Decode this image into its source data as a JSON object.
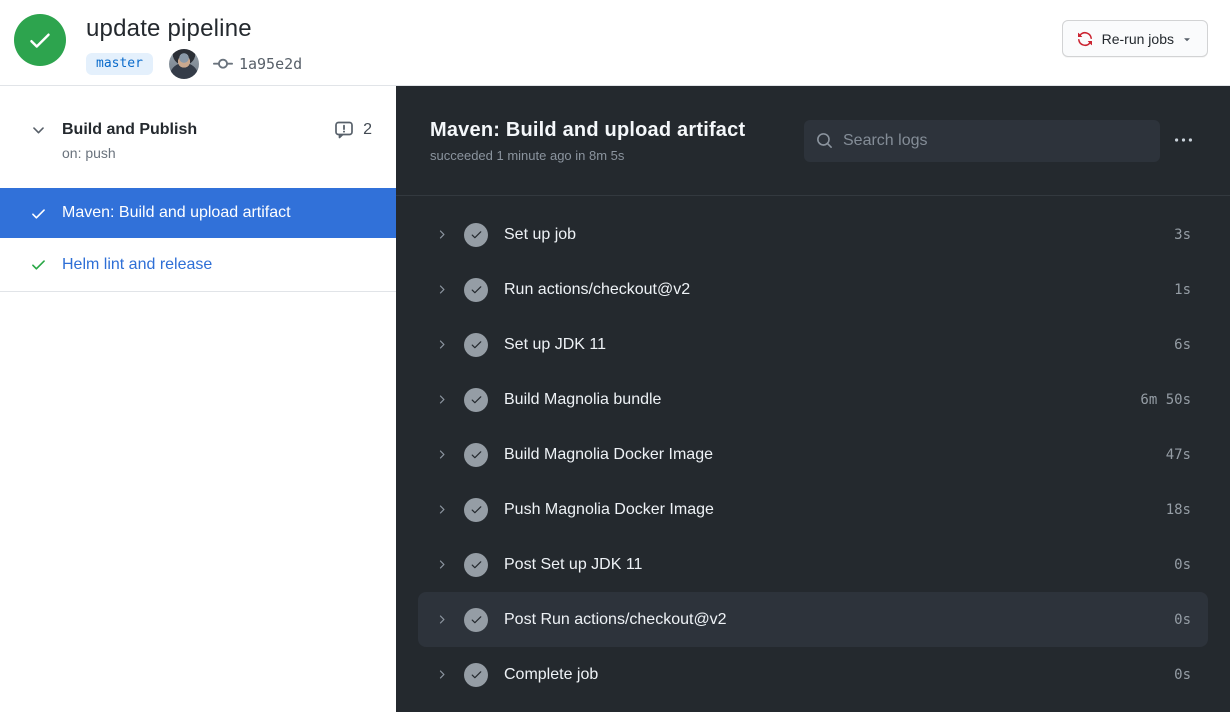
{
  "header": {
    "status": "success",
    "title": "update pipeline",
    "branch": "master",
    "commit_sha": "1a95e2d",
    "rerun_label": "Re-run jobs"
  },
  "sidebar": {
    "workflow_name": "Build and Publish",
    "trigger": "on: push",
    "annotations_count": "2",
    "jobs": [
      {
        "name": "Maven: Build and upload artifact",
        "status": "success",
        "selected": true
      },
      {
        "name": "Helm lint and release",
        "status": "success",
        "selected": false
      }
    ]
  },
  "main": {
    "job_title": "Maven: Build and upload artifact",
    "job_subtitle": "succeeded 1 minute ago in 8m 5s",
    "search": {
      "placeholder": "Search logs",
      "value": ""
    },
    "steps": [
      {
        "name": "Set up job",
        "duration": "3s",
        "status": "success",
        "highlighted": false
      },
      {
        "name": "Run actions/checkout@v2",
        "duration": "1s",
        "status": "success",
        "highlighted": false
      },
      {
        "name": "Set up JDK 11",
        "duration": "6s",
        "status": "success",
        "highlighted": false
      },
      {
        "name": "Build Magnolia bundle",
        "duration": "6m 50s",
        "status": "success",
        "highlighted": false
      },
      {
        "name": "Build Magnolia Docker Image",
        "duration": "47s",
        "status": "success",
        "highlighted": false
      },
      {
        "name": "Push Magnolia Docker Image",
        "duration": "18s",
        "status": "success",
        "highlighted": false
      },
      {
        "name": "Post Set up JDK 11",
        "duration": "0s",
        "status": "success",
        "highlighted": false
      },
      {
        "name": "Post Run actions/checkout@v2",
        "duration": "0s",
        "status": "success",
        "highlighted": true
      },
      {
        "name": "Complete job",
        "duration": "0s",
        "status": "success",
        "highlighted": false
      }
    ]
  },
  "icons": {
    "status-circle": "check-circle",
    "branch-meta": "git-commit-icon",
    "rerun": "sync-icon",
    "workflow-expand": "chevron-down-icon",
    "annotations": "comment-alert-icon",
    "step-expand": "chevron-right-icon",
    "search": "search-icon",
    "menu": "kebab-horizontal-icon"
  },
  "colors": {
    "success_green": "#2da44e",
    "sidebar_selected_blue": "#3171d9",
    "link_blue": "#2e6fd6",
    "panel_bg": "#24292e",
    "panel_row_hover": "#2d333b",
    "muted_gray": "#8b949e",
    "rerun_icon_red": "#cb2431",
    "branch_badge_bg": "#e4f0fc",
    "branch_badge_text": "#0b6bcb"
  }
}
